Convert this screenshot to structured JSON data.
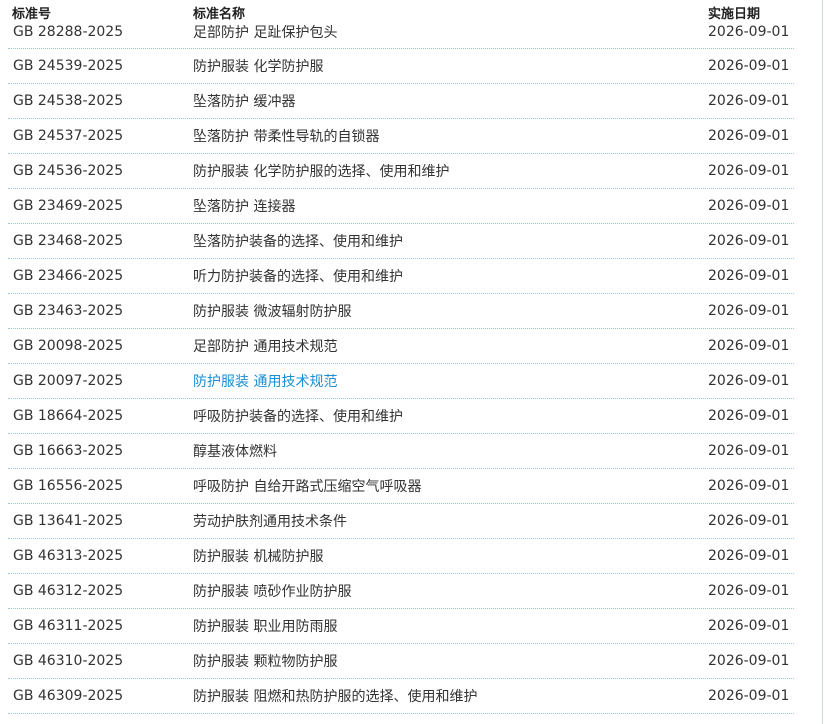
{
  "header": {
    "col_no": "标准号",
    "col_name": "标准名称",
    "col_date": "实施日期"
  },
  "rows": [
    {
      "no": "GB 28288-2025",
      "name": "足部防护 足趾保护包头",
      "date": "2026-09-01"
    },
    {
      "no": "GB 24539-2025",
      "name": "防护服装 化学防护服",
      "date": "2026-09-01"
    },
    {
      "no": "GB 24538-2025",
      "name": "坠落防护 缓冲器",
      "date": "2026-09-01"
    },
    {
      "no": "GB 24537-2025",
      "name": "坠落防护 带柔性导轨的自锁器",
      "date": "2026-09-01"
    },
    {
      "no": "GB 24536-2025",
      "name": "防护服装 化学防护服的选择、使用和维护",
      "date": "2026-09-01"
    },
    {
      "no": "GB 23469-2025",
      "name": "坠落防护 连接器",
      "date": "2026-09-01"
    },
    {
      "no": "GB 23468-2025",
      "name": "坠落防护装备的选择、使用和维护",
      "date": "2026-09-01"
    },
    {
      "no": "GB 23466-2025",
      "name": "听力防护装备的选择、使用和维护",
      "date": "2026-09-01"
    },
    {
      "no": "GB 23463-2025",
      "name": "防护服装 微波辐射防护服",
      "date": "2026-09-01"
    },
    {
      "no": "GB 20098-2025",
      "name": "足部防护 通用技术规范",
      "date": "2026-09-01"
    },
    {
      "no": "GB 20097-2025",
      "name": "防护服装 通用技术规范",
      "date": "2026-09-01"
    },
    {
      "no": "GB 18664-2025",
      "name": "呼吸防护装备的选择、使用和维护",
      "date": "2026-09-01"
    },
    {
      "no": "GB 16663-2025",
      "name": "醇基液体燃料",
      "date": "2026-09-01"
    },
    {
      "no": "GB 16556-2025",
      "name": "呼吸防护 自给开路式压缩空气呼吸器",
      "date": "2026-09-01"
    },
    {
      "no": "GB 13641-2025",
      "name": "劳动护肤剂通用技术条件",
      "date": "2026-09-01"
    },
    {
      "no": "GB 46313-2025",
      "name": "防护服装 机械防护服",
      "date": "2026-09-01"
    },
    {
      "no": "GB 46312-2025",
      "name": "防护服装 喷砂作业防护服",
      "date": "2026-09-01"
    },
    {
      "no": "GB 46311-2025",
      "name": "防护服装 职业用防雨服",
      "date": "2026-09-01"
    },
    {
      "no": "GB 46310-2025",
      "name": "防护服装 颗粒物防护服",
      "date": "2026-09-01"
    },
    {
      "no": "GB 46309-2025",
      "name": "防护服装 阻燃和热防护服的选择、使用和维护",
      "date": "2026-09-01"
    }
  ],
  "colors": {
    "link_highlight": "#1a8fd6",
    "row_divider": "#9fc4dd"
  }
}
